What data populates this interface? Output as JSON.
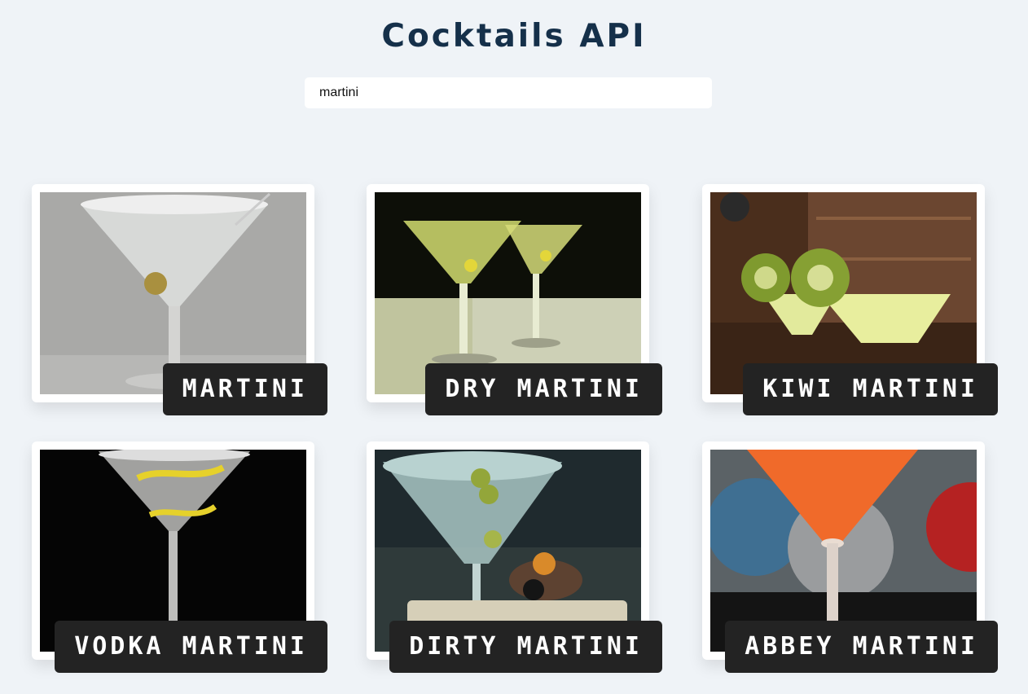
{
  "header": {
    "title": "Cocktails API"
  },
  "search": {
    "value": "martini"
  },
  "drinks": [
    {
      "name": "MARTINI"
    },
    {
      "name": "DRY MARTINI"
    },
    {
      "name": "KIWI MARTINI"
    },
    {
      "name": "VODKA MARTINI"
    },
    {
      "name": "DIRTY MARTINI"
    },
    {
      "name": "ABBEY MARTINI"
    }
  ]
}
